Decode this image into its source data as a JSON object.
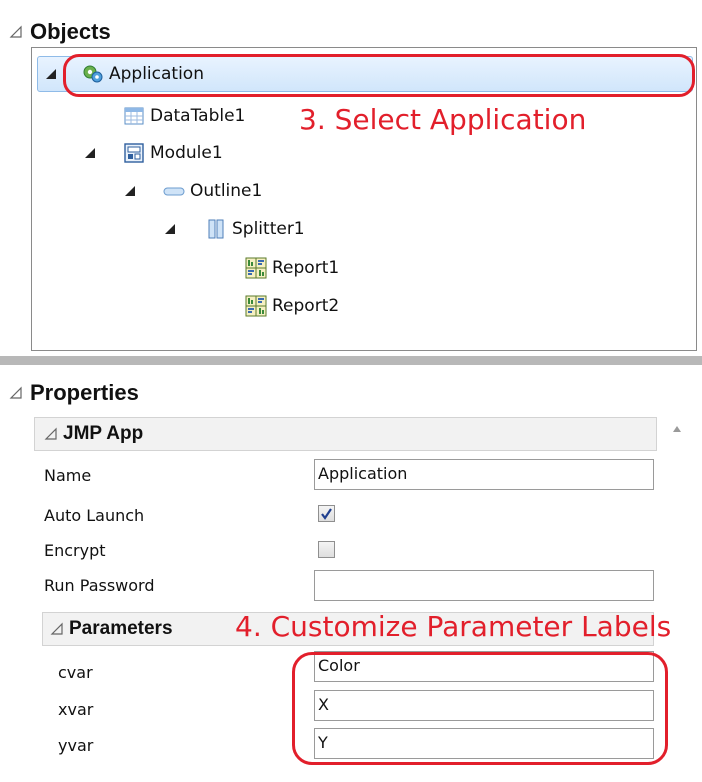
{
  "objects": {
    "title": "Objects",
    "tree": [
      {
        "label": "Application",
        "icon": "application-icon"
      },
      {
        "label": "DataTable1",
        "icon": "datatable-icon"
      },
      {
        "label": "Module1",
        "icon": "module-icon"
      },
      {
        "label": "Outline1",
        "icon": "outline-icon"
      },
      {
        "label": "Splitter1",
        "icon": "splitter-icon"
      },
      {
        "label": "Report1",
        "icon": "report-icon"
      },
      {
        "label": "Report2",
        "icon": "report-icon"
      }
    ]
  },
  "annotations": {
    "step3": "3. Select Application",
    "step4": "4. Customize Parameter Labels",
    "color": "#e21f2b"
  },
  "properties": {
    "title": "Properties",
    "jmp_app": {
      "title": "JMP App",
      "name_label": "Name",
      "name_value": "Application",
      "auto_launch_label": "Auto Launch",
      "auto_launch_checked": true,
      "encrypt_label": "Encrypt",
      "encrypt_checked": false,
      "run_password_label": "Run Password",
      "run_password_value": ""
    },
    "parameters": {
      "title": "Parameters",
      "rows": [
        {
          "label": "cvar",
          "value": "Color"
        },
        {
          "label": "xvar",
          "value": "X"
        },
        {
          "label": "yvar",
          "value": "Y"
        }
      ]
    }
  }
}
